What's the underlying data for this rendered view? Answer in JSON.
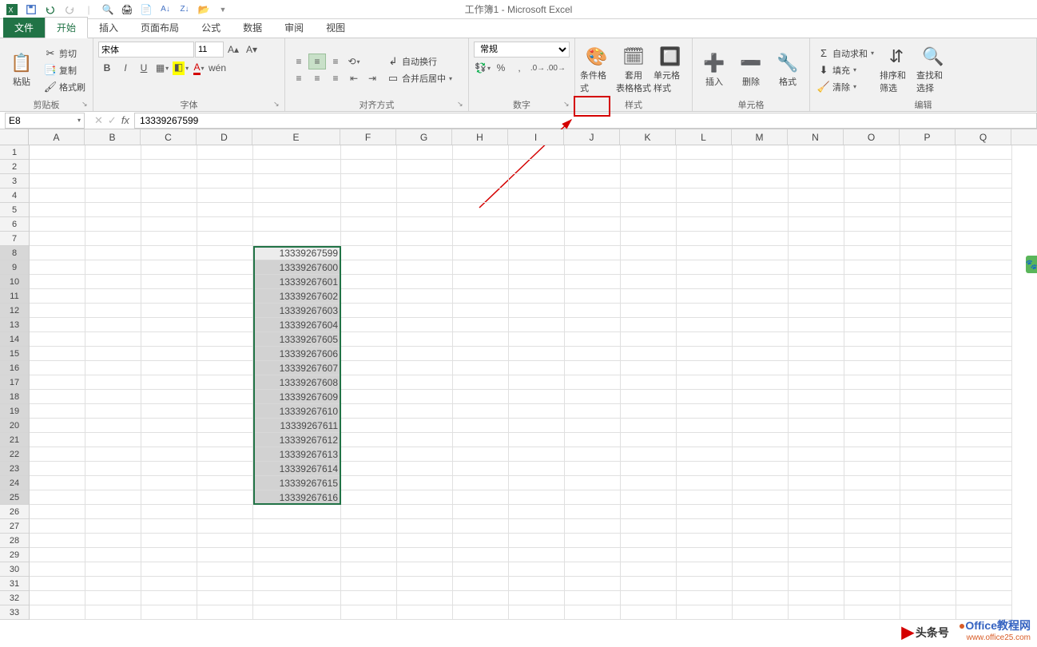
{
  "title": "工作簿1 - Microsoft Excel",
  "tabs": {
    "file": "文件",
    "start": "开始",
    "insert": "插入",
    "layout": "页面布局",
    "formula": "公式",
    "data": "数据",
    "review": "审阅",
    "view": "视图"
  },
  "clipboard": {
    "label": "剪贴板",
    "paste": "粘贴",
    "cut": "剪切",
    "copy": "复制",
    "painter": "格式刷"
  },
  "font": {
    "label": "字体",
    "name": "宋体",
    "size": "11",
    "bold": "B",
    "italic": "I",
    "underline": "U",
    "pinyin": "wén"
  },
  "align": {
    "label": "对齐方式",
    "wrap": "自动换行",
    "merge": "合并后居中"
  },
  "number": {
    "label": "数字",
    "format": "常规",
    "percent": "%",
    "comma": ","
  },
  "styles": {
    "label": "样式",
    "cond": "条件格式",
    "table": "套用\n表格格式",
    "cell": "单元格样式"
  },
  "cells_grp": {
    "label": "单元格",
    "insert": "插入",
    "delete": "删除",
    "format": "格式"
  },
  "editing": {
    "label": "编辑",
    "sum": "自动求和",
    "fill": "填充",
    "clear": "清除",
    "sort": "排序和筛选",
    "find": "查找和选择"
  },
  "name_box": "E8",
  "formula_value": "13339267599",
  "cols": [
    "A",
    "B",
    "C",
    "D",
    "E",
    "F",
    "G",
    "H",
    "I",
    "J",
    "K",
    "L",
    "M",
    "N",
    "O",
    "P",
    "Q"
  ],
  "row_nums": [
    1,
    2,
    3,
    4,
    5,
    6,
    7,
    8,
    9,
    10,
    11,
    12,
    13,
    14,
    15,
    16,
    17,
    18,
    19,
    20,
    21,
    22,
    23,
    24,
    25,
    26,
    27,
    28,
    29,
    30,
    31,
    32,
    33
  ],
  "data_rows": [
    "13339267599",
    "13339267600",
    "13339267601",
    "13339267602",
    "13339267603",
    "13339267604",
    "13339267605",
    "13339267606",
    "13339267607",
    "13339267608",
    "13339267609",
    "13339267610",
    "13339267611",
    "13339267612",
    "13339267613",
    "13339267614",
    "13339267615",
    "13339267616"
  ],
  "watermark": {
    "tt": "头条号",
    "off": "Office教程网",
    "url": "www.office25.com"
  }
}
